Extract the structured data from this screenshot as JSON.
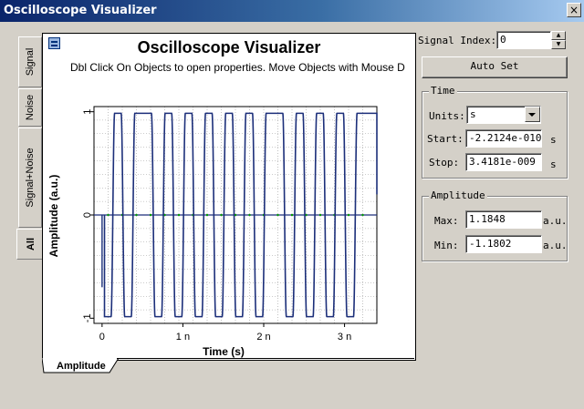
{
  "window": {
    "title": "Oscilloscope Visualizer",
    "close_glyph": "×"
  },
  "side_tabs": [
    {
      "label": "Signal"
    },
    {
      "label": "Noise"
    },
    {
      "label": "Signal+Noise"
    },
    {
      "label": "All"
    }
  ],
  "plot": {
    "title": "Oscilloscope Visualizer",
    "hint": "Dbl Click On Objects to open properties.  Move Objects with Mouse D",
    "bottom_tab": "Amplitude",
    "icon": "plot-window-icon"
  },
  "chart_data": {
    "type": "line",
    "title": "",
    "xlabel": "Time (s)",
    "ylabel": "Amplitude (a.u.)",
    "xlim": [
      -1e-10,
      3.4e-09
    ],
    "ylim": [
      -1.05,
      1.05
    ],
    "x_ticks": [
      "0",
      "1 n",
      "2 n",
      "3 n"
    ],
    "y_ticks": [
      "1",
      "0",
      "-1"
    ],
    "grid": true,
    "series": [
      {
        "color": "#1c2f7a",
        "bits": [
          0,
          1,
          0,
          1,
          1,
          0,
          1,
          0,
          1,
          0,
          1,
          0,
          1,
          0,
          1,
          0,
          1,
          1,
          0,
          1,
          0,
          1,
          0,
          1,
          0,
          1
        ],
        "bit_period_ns": 0.125,
        "start_ns": 0.03,
        "end_ns": 3.4
      },
      {
        "color": "#00a000",
        "values": "zero baseline"
      }
    ],
    "colors": {
      "grid": "#9a9a9a",
      "frame": "#000000"
    }
  },
  "signal_index": {
    "label": "Signal Index:",
    "value": "0"
  },
  "auto_set": {
    "label": "Auto Set"
  },
  "time_group": {
    "title": "Time",
    "units_label": "Units:",
    "units_value": "s",
    "start_label": "Start:",
    "start_value": "-2.2124e-010",
    "start_unit": "s",
    "stop_label": "Stop:",
    "stop_value": "3.4181e-009",
    "stop_unit": "s"
  },
  "amplitude_group": {
    "title": "Amplitude",
    "max_label": "Max:",
    "max_value": "1.1848",
    "max_unit": "a.u.",
    "min_label": "Min:",
    "min_value": "-1.1802",
    "min_unit": "a.u."
  }
}
